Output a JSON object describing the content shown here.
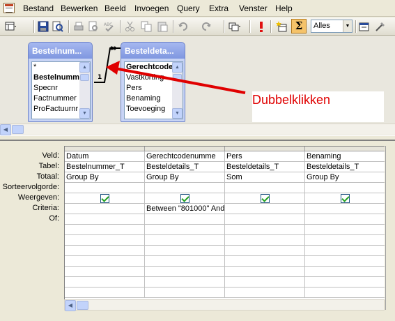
{
  "menubar": {
    "items": [
      "Bestand",
      "Bewerken",
      "Beeld",
      "Invoegen",
      "Query",
      "Extra",
      "Venster",
      "Help"
    ]
  },
  "toolbar": {
    "sigma_label": "Σ",
    "top_values_combo": "Alles"
  },
  "diagram": {
    "tables": [
      {
        "title": "Bestelnum...",
        "fields": [
          "*",
          "Bestelnummer",
          "Specnr",
          "Factnummer",
          "ProFactuurnr"
        ],
        "bold_field": "Bestelnummer"
      },
      {
        "title": "Besteldeta...",
        "fields": [
          "Gerechtcoder",
          "Vastkorting",
          "Pers",
          "Benaming",
          "Toevoeging"
        ],
        "bold_field": "Gerechtcoder"
      }
    ],
    "join": {
      "one_label": "1",
      "many_label": "∞"
    },
    "annotation": "Dubbelklikken",
    "annotation_color": "#e00000"
  },
  "grid": {
    "row_labels": [
      "Veld:",
      "Tabel:",
      "Totaal:",
      "Sorteervolgorde:",
      "Weergeven:",
      "Criteria:",
      "Of:"
    ],
    "columns": [
      {
        "veld": "Datum",
        "tabel": "Bestelnummer_T",
        "totaal": "Group By",
        "sort": "",
        "weergeven": true,
        "criteria": "",
        "of": ""
      },
      {
        "veld": "Gerechtcodenumme",
        "tabel": "Besteldetails_T",
        "totaal": "Group By",
        "sort": "",
        "weergeven": true,
        "criteria": "Between \"801000\" And",
        "of": ""
      },
      {
        "veld": "Pers",
        "tabel": "Besteldetails_T",
        "totaal": "Som",
        "sort": "",
        "weergeven": true,
        "criteria": "",
        "of": ""
      },
      {
        "veld": "Benaming",
        "tabel": "Besteldetails_T",
        "totaal": "Group By",
        "sort": "",
        "weergeven": true,
        "criteria": "",
        "of": ""
      }
    ]
  }
}
